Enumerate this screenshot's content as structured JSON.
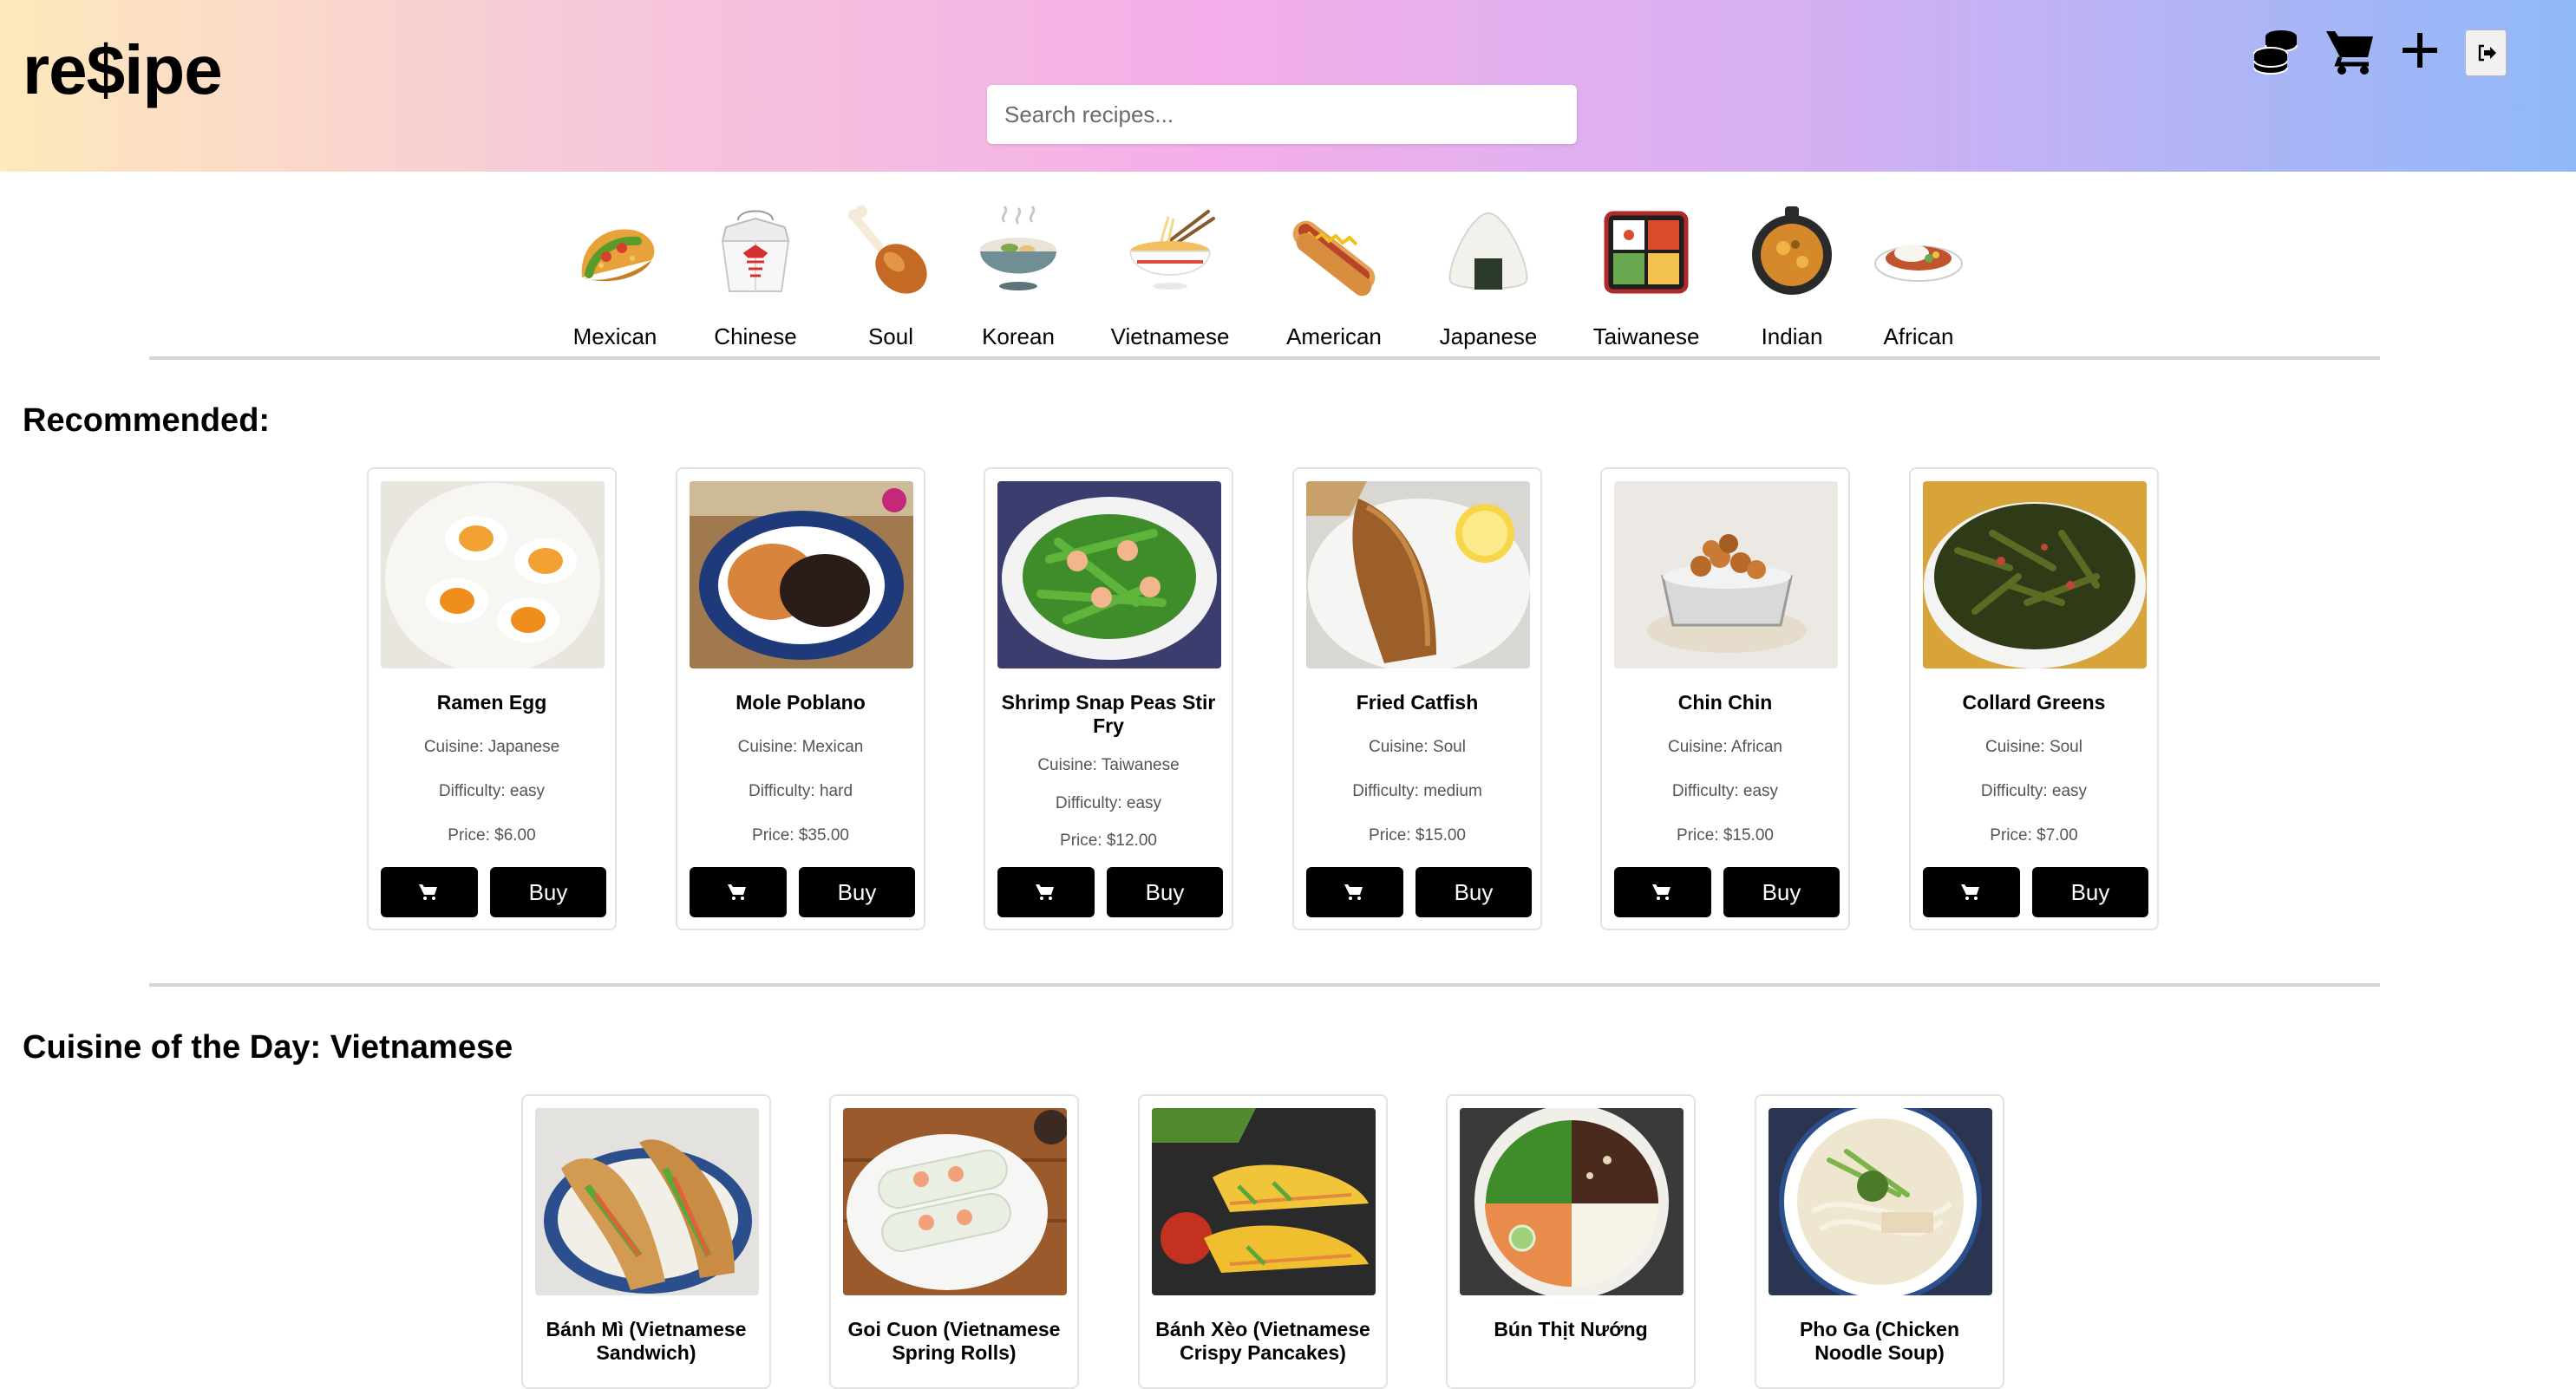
{
  "header": {
    "logo": "re$ipe",
    "search_placeholder": "Search recipes...",
    "icons": [
      "coins-icon",
      "cart-icon",
      "plus-icon",
      "logout-icon"
    ]
  },
  "categories": [
    {
      "label": "Mexican",
      "icon": "taco-emoji"
    },
    {
      "label": "Chinese",
      "icon": "takeout-box-emoji"
    },
    {
      "label": "Soul",
      "icon": "poultry-leg-emoji"
    },
    {
      "label": "Korean",
      "icon": "stew-bowl-emoji"
    },
    {
      "label": "Vietnamese",
      "icon": "noodle-bowl-emoji"
    },
    {
      "label": "American",
      "icon": "hot-dog-emoji"
    },
    {
      "label": "Japanese",
      "icon": "rice-ball-emoji"
    },
    {
      "label": "Taiwanese",
      "icon": "bento-box-emoji"
    },
    {
      "label": "Indian",
      "icon": "curry-pot-emoji"
    },
    {
      "label": "African",
      "icon": "curry-rice-emoji"
    }
  ],
  "recommended": {
    "title": "Recommended:",
    "buy_label": "Buy",
    "items": [
      {
        "name": "Ramen Egg",
        "cuisine": "Cuisine: Japanese",
        "difficulty": "Difficulty: easy",
        "price": "Price: $6.00"
      },
      {
        "name": "Mole Poblano",
        "cuisine": "Cuisine: Mexican",
        "difficulty": "Difficulty: hard",
        "price": "Price: $35.00"
      },
      {
        "name": "Shrimp Snap Peas Stir Fry",
        "cuisine": "Cuisine: Taiwanese",
        "difficulty": "Difficulty: easy",
        "price": "Price: $12.00"
      },
      {
        "name": "Fried Catfish",
        "cuisine": "Cuisine: Soul",
        "difficulty": "Difficulty: medium",
        "price": "Price: $15.00"
      },
      {
        "name": "Chin Chin",
        "cuisine": "Cuisine: African",
        "difficulty": "Difficulty: easy",
        "price": "Price: $15.00"
      },
      {
        "name": "Collard Greens",
        "cuisine": "Cuisine: Soul",
        "difficulty": "Difficulty: easy",
        "price": "Price: $7.00"
      }
    ]
  },
  "cuisine_of_day": {
    "title": "Cuisine of the Day: Vietnamese",
    "items": [
      {
        "name": "Bánh Mì (Vietnamese Sandwich)"
      },
      {
        "name": "Goi Cuon (Vietnamese Spring Rolls)"
      },
      {
        "name": "Bánh Xèo (Vietnamese Crispy Pancakes)"
      },
      {
        "name": "Bún Thịt Nướng"
      },
      {
        "name": "Pho Ga (Chicken Noodle Soup)"
      }
    ]
  },
  "colors": {
    "header_gradient": [
      "#fde9bb",
      "#f6c9d9",
      "#f3aee9",
      "#d5b0f2",
      "#90b8f9"
    ],
    "button_bg": "#000000",
    "divider": "#d6d6d6"
  }
}
